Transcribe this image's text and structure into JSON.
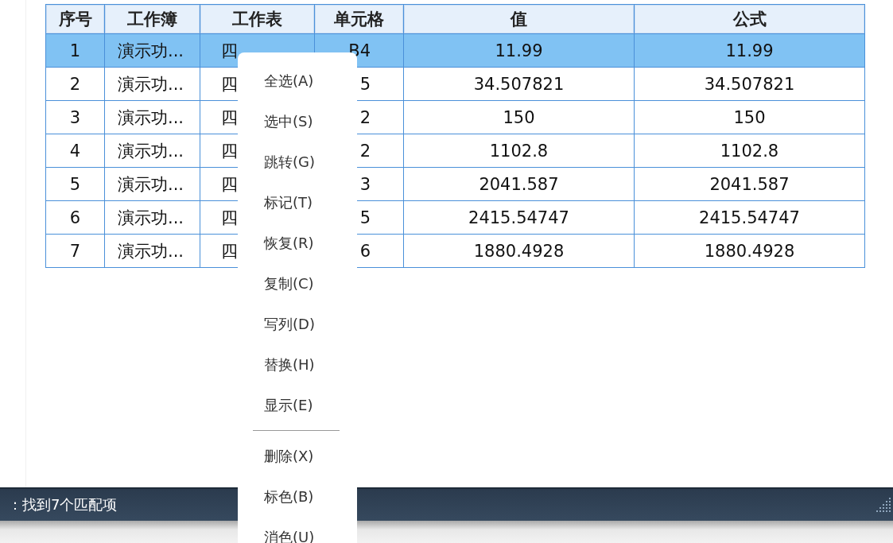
{
  "table": {
    "columns": [
      "序号",
      "工作簿",
      "工作表",
      "单元格",
      "值",
      "公式"
    ],
    "rows": [
      {
        "selected": true,
        "cells": [
          "1",
          "演示功...",
          "四",
          "B4",
          "11.99",
          "11.99"
        ]
      },
      {
        "selected": false,
        "cells": [
          "2",
          "演示功...",
          "四",
          "5",
          "34.507821",
          "34.507821"
        ]
      },
      {
        "selected": false,
        "cells": [
          "3",
          "演示功...",
          "四",
          "2",
          "150",
          "150"
        ]
      },
      {
        "selected": false,
        "cells": [
          "4",
          "演示功...",
          "四",
          "2",
          "1102.8",
          "1102.8"
        ]
      },
      {
        "selected": false,
        "cells": [
          "5",
          "演示功...",
          "四",
          "3",
          "2041.587",
          "2041.587"
        ]
      },
      {
        "selected": false,
        "cells": [
          "6",
          "演示功...",
          "四",
          "5",
          "2415.54747",
          "2415.54747"
        ]
      },
      {
        "selected": false,
        "cells": [
          "7",
          "演示功...",
          "四",
          "6",
          "1880.4928",
          "1880.4928"
        ]
      }
    ]
  },
  "context_menu": {
    "items": [
      {
        "kind": "item",
        "label": "全选(A)"
      },
      {
        "kind": "item",
        "label": "选中(S)"
      },
      {
        "kind": "item",
        "label": "跳转(G)"
      },
      {
        "kind": "item",
        "label": "标记(T)"
      },
      {
        "kind": "item",
        "label": "恢复(R)"
      },
      {
        "kind": "item",
        "label": "复制(C)"
      },
      {
        "kind": "item",
        "label": "写列(D)"
      },
      {
        "kind": "item",
        "label": "替换(H)"
      },
      {
        "kind": "item",
        "label": "显示(E)"
      },
      {
        "kind": "separator"
      },
      {
        "kind": "item",
        "label": "删除(X)"
      },
      {
        "kind": "item",
        "label": "标色(B)"
      },
      {
        "kind": "item",
        "label": "消色(U)"
      }
    ]
  },
  "status_bar": {
    "text": "：找到7个匹配项"
  }
}
